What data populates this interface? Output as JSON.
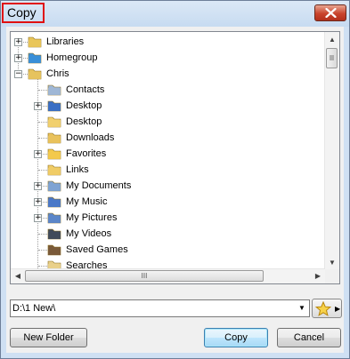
{
  "window": {
    "title": "Copy"
  },
  "tree": {
    "items": [
      {
        "label": "Libraries",
        "icon": "libraries-icon",
        "expander": "+"
      },
      {
        "label": "Homegroup",
        "icon": "homegroup-icon",
        "expander": "+"
      },
      {
        "label": "Chris",
        "icon": "user-folder-icon",
        "expander": "−"
      },
      {
        "label": "Contacts",
        "icon": "contacts-folder-icon",
        "expander": ""
      },
      {
        "label": "Desktop",
        "icon": "desktop-folder-icon",
        "expander": "+"
      },
      {
        "label": "Desktop",
        "icon": "folder-icon",
        "expander": ""
      },
      {
        "label": "Downloads",
        "icon": "downloads-folder-icon",
        "expander": ""
      },
      {
        "label": "Favorites",
        "icon": "favorites-folder-icon",
        "expander": "+"
      },
      {
        "label": "Links",
        "icon": "links-folder-icon",
        "expander": ""
      },
      {
        "label": "My Documents",
        "icon": "documents-folder-icon",
        "expander": "+"
      },
      {
        "label": "My Music",
        "icon": "music-folder-icon",
        "expander": "+"
      },
      {
        "label": "My Pictures",
        "icon": "pictures-folder-icon",
        "expander": "+"
      },
      {
        "label": "My Videos",
        "icon": "videos-folder-icon",
        "expander": ""
      },
      {
        "label": "Saved Games",
        "icon": "saved-games-folder-icon",
        "expander": ""
      },
      {
        "label": "Searches",
        "icon": "searches-folder-icon",
        "expander": ""
      }
    ]
  },
  "path": {
    "value": "D:\\1 New\\"
  },
  "buttons": {
    "new_folder": "New Folder",
    "copy": "Copy",
    "cancel": "Cancel"
  },
  "scroll": {
    "grip": "III"
  }
}
